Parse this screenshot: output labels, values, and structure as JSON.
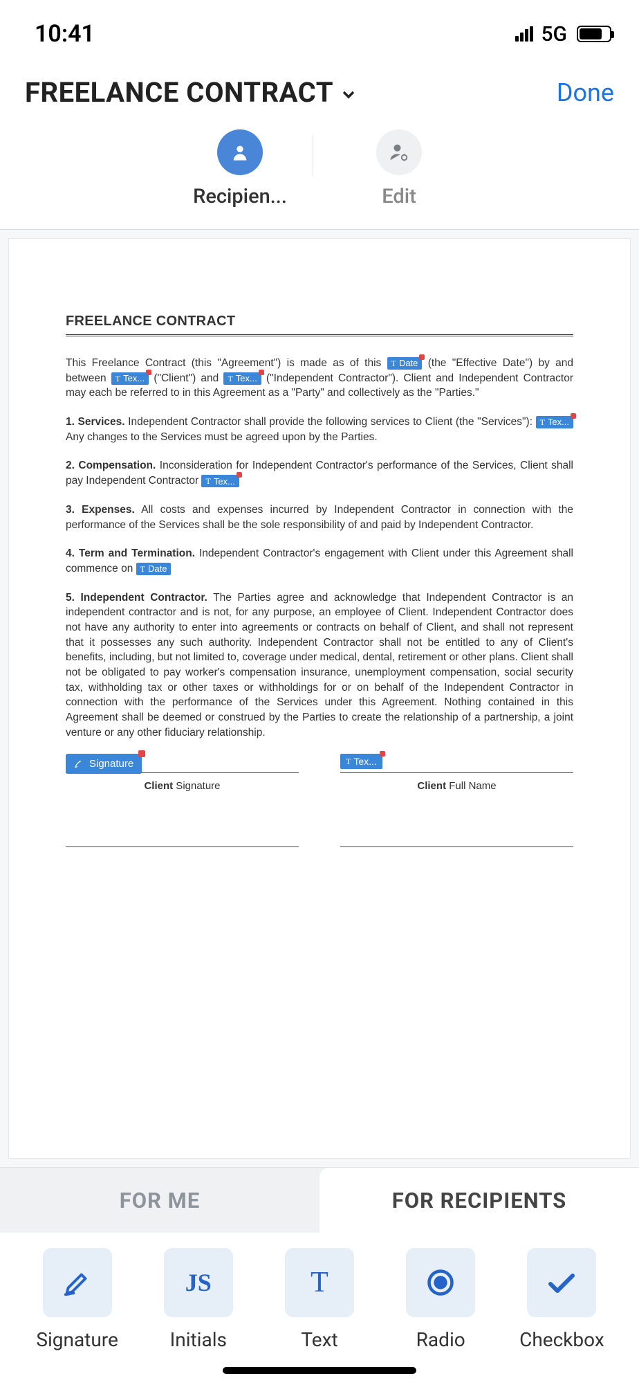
{
  "status": {
    "time": "10:41",
    "network": "5G"
  },
  "header": {
    "title": "FREELANCE CONTRACT",
    "done": "Done"
  },
  "modes": {
    "recipients": "Recipien...",
    "edit": "Edit"
  },
  "doc": {
    "heading": "FREELANCE CONTRACT",
    "intro1": "This Freelance Contract (this  \"Agreement\") is made as of this ",
    "intro2": " (the \"Effective Date\") by and between ",
    "intro3": " (\"Client\") and ",
    "intro4": " (\"Independent Contractor\"). Client and Independent Contractor may each be referred to in this Agreement as a \"Party\" and collectively as the \"Parties.\"",
    "s1_label": "1. Services.",
    "s1_a": " Independent Contractor shall provide the following services to Client (the \"Services\"): ",
    "s1_b": " Any changes to the Services must be agreed upon by the Parties.",
    "s2_label": "2. Compensation.",
    "s2_a": " Inconsideration for Independent Contractor's performance of the Services, Client shall pay Independent Contractor ",
    "s3_label": "3. Expenses.",
    "s3_a": " All costs and expenses incurred by Independent Contractor in connection with the performance of the Services shall be the sole responsibility of and paid by Independent Contractor.",
    "s4_label": "4. Term and Termination.",
    "s4_a": " Independent Contractor's engagement with Client under this Agreement shall commence on ",
    "s5_label": "5. Independent Contractor.",
    "s5_a": " The Parties agree and acknowledge that Independent Contractor is an independent contractor and is not, for any purpose, an employee of Client.  Independent Contractor does not have any authority to enter into agreements or contracts on behalf of Client, and shall not represent that it possesses any such authority. Independent Contractor shall not be entitled to any of Client's benefits, including, but not limited to, coverage under medical, dental, retirement or other plans. Client shall not be obligated to pay worker's compensation insurance, unemployment compensation, social security tax, withholding tax or other taxes or withholdings for or on behalf of the Independent Contractor in connection with the performance of the Services under this Agreement. Nothing contained in this Agreement shall be deemed or construed by the Parties to create the relationship of a partnership, a joint venture or any other fiduciary relationship.",
    "fields": {
      "date": "Date",
      "text": "Tex...",
      "signature": "Signature"
    },
    "sig_label_bold": "Client",
    "sig_label_a": " Signature",
    "sig_label_b": " Full Name"
  },
  "tabs": {
    "forMe": "FOR ME",
    "forRecipients": "FOR RECIPIENTS"
  },
  "tools": {
    "signature": "Signature",
    "initials": "Initials",
    "initials_icon": "JS",
    "text": "Text",
    "radio": "Radio",
    "checkbox": "Checkbox"
  }
}
